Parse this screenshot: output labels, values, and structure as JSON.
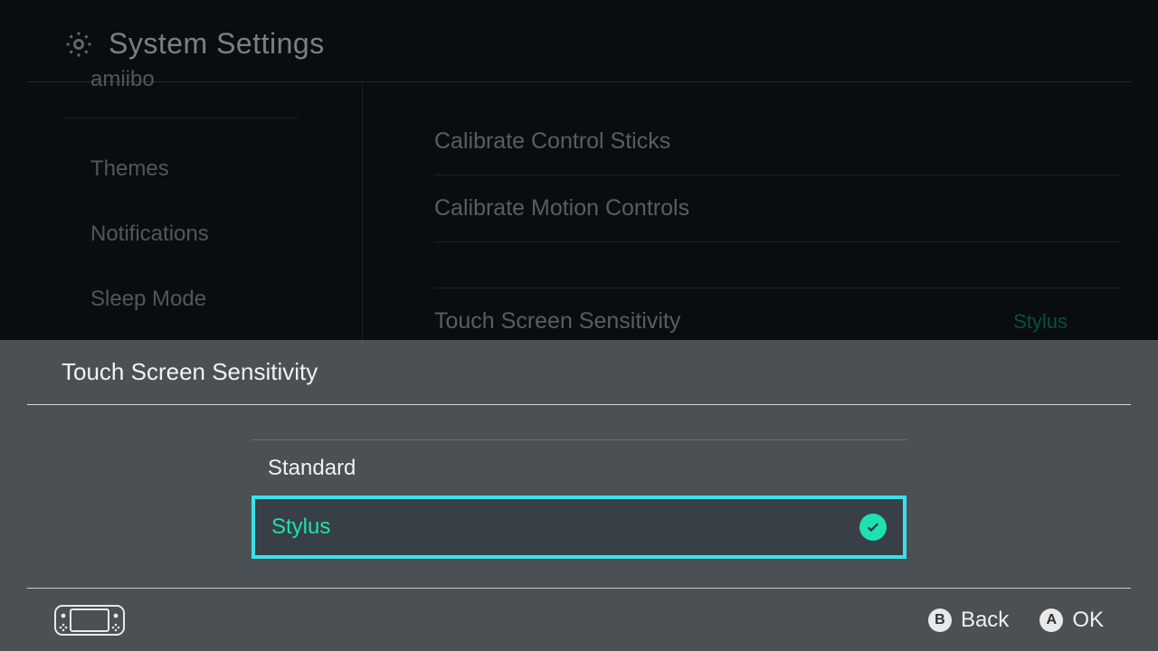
{
  "header": {
    "title": "System Settings"
  },
  "sidebar": {
    "items": [
      {
        "label": "amiibo"
      },
      {
        "label": "Themes"
      },
      {
        "label": "Notifications"
      },
      {
        "label": "Sleep Mode"
      }
    ]
  },
  "main": {
    "items": [
      {
        "label": "Calibrate Control Sticks"
      },
      {
        "label": "Calibrate Motion Controls"
      }
    ],
    "sensitivity": {
      "label": "Touch Screen Sensitivity",
      "value": "Stylus"
    }
  },
  "modal": {
    "title": "Touch Screen Sensitivity",
    "options": [
      {
        "label": "Standard",
        "selected": false
      },
      {
        "label": "Stylus",
        "selected": true
      }
    ]
  },
  "footer": {
    "back": {
      "glyph": "B",
      "label": "Back"
    },
    "ok": {
      "glyph": "A",
      "label": "OK"
    }
  }
}
